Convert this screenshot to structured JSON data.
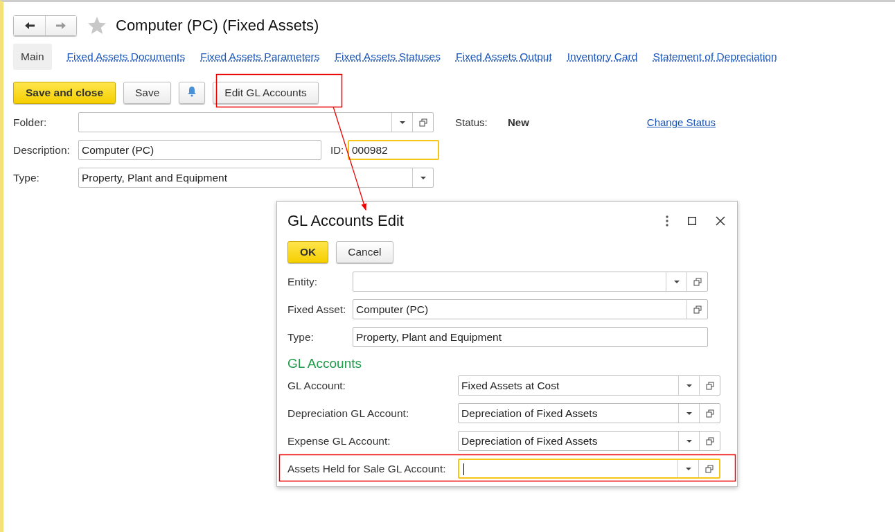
{
  "window": {
    "title": "Computer (PC) (Fixed Assets)",
    "favorite": false
  },
  "tabs": [
    {
      "label": "Main",
      "selected": true
    },
    {
      "label": "Fixed Assets Documents",
      "selected": false
    },
    {
      "label": "Fixed Assets Parameters",
      "selected": false
    },
    {
      "label": "Fixed Assets Statuses",
      "selected": false
    },
    {
      "label": "Fixed Assets Output",
      "selected": false
    },
    {
      "label": "Inventory Card",
      "selected": false
    },
    {
      "label": "Statement of Depreciation",
      "selected": false
    }
  ],
  "toolbar": {
    "primary": "Save and close",
    "save": "Save",
    "edit": "Edit GL Accounts"
  },
  "form": {
    "folder": {
      "label": "Folder:",
      "kind": "select",
      "focused": false
    },
    "description": {
      "label": "Description:",
      "value": "Computer (PC)",
      "focused": false
    },
    "id": {
      "label": "ID:",
      "value": "000982",
      "focused": true
    },
    "type": {
      "label": "Type:",
      "value": "Property, Plant and Equipment",
      "kind": "dropdown",
      "focused": false
    },
    "status": {
      "label": "Status:",
      "value": "New",
      "link": "Change Status"
    }
  },
  "dialog": {
    "title": "GL Accounts Edit",
    "ok": "OK",
    "cancel": "Cancel",
    "fields": [
      {
        "label": "Entity:",
        "kind": "select",
        "focused": false
      },
      {
        "label": "Fixed Asset:",
        "value": "Computer (PC)",
        "kind": "open",
        "focused": false
      },
      {
        "label": "Type:",
        "value": "Property, Plant and Equipment",
        "kind": "text",
        "focused": false
      }
    ],
    "section": "GL Accounts",
    "accounts": [
      {
        "label": "GL Account:",
        "value": "Fixed Assets at Cost",
        "kind": "select",
        "focused": false
      },
      {
        "label": "Depreciation GL Account:",
        "value": "Depreciation of Fixed Assets",
        "kind": "select",
        "focused": false
      },
      {
        "label": "Expense GL Account:",
        "value": "Depreciation of Fixed Assets",
        "kind": "select",
        "focused": false
      },
      {
        "label": "Assets Held for Sale GL Account:",
        "kind": "select",
        "focused": true
      }
    ]
  }
}
